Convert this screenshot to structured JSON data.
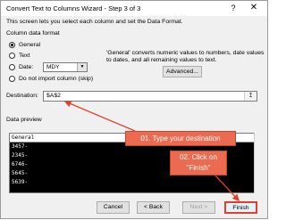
{
  "window": {
    "title": "Convert Text to Columns Wizard - Step 3 of 3",
    "help_glyph": "?",
    "close_glyph": "✕"
  },
  "intro_text": "This screen lets you select each column and set the Data Format.",
  "column_format": {
    "label": "Column data format",
    "options": [
      {
        "label": "General",
        "selected": true
      },
      {
        "label": "Text",
        "selected": false
      },
      {
        "label": "Date:",
        "selected": false
      },
      {
        "label": "Do not import column (skip)",
        "selected": false
      }
    ],
    "date_value": "MDY"
  },
  "description": "'General' converts numeric values to numbers, date values to dates, and all remaining values to text.",
  "advanced_label": "Advanced...",
  "destination": {
    "label": "Destination:",
    "value": "$A$2"
  },
  "preview": {
    "label": "Data preview",
    "header": "General",
    "rows": [
      "3457-",
      "2345-",
      "6746-",
      "5645-",
      "5639-"
    ]
  },
  "annotations": {
    "callout1": "01. Type your destination",
    "callout2_line1": "02. Click on",
    "callout2_line2": "\"Finish\""
  },
  "buttons": {
    "cancel": "Cancel",
    "back": "< Back",
    "next": "Next >",
    "finish": "Finish"
  },
  "colors": {
    "callout": "#ec6b50",
    "arrow": "#e0402a"
  }
}
